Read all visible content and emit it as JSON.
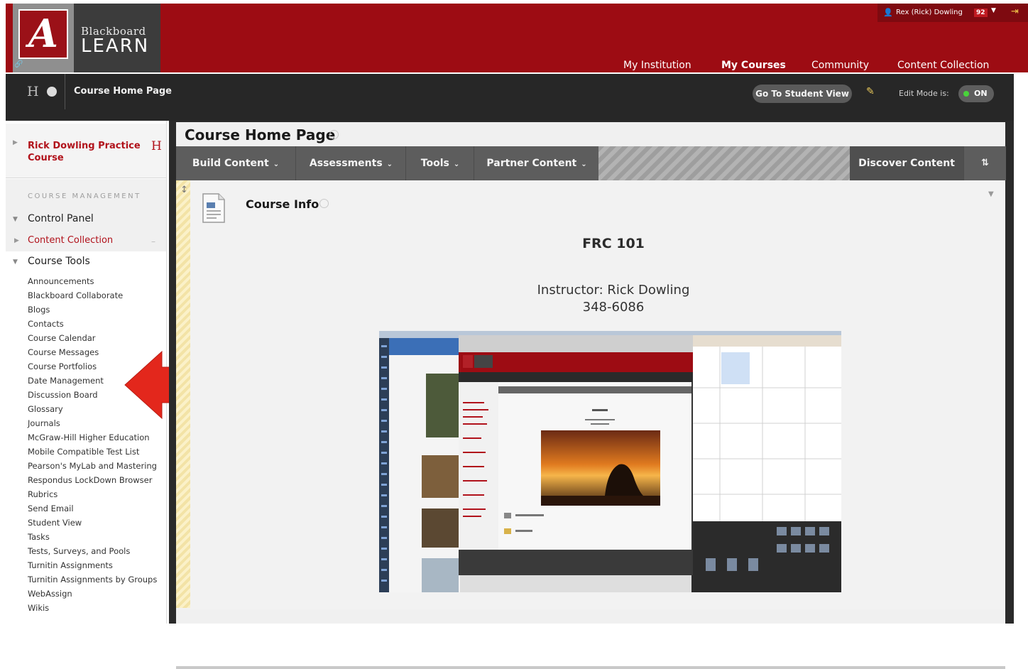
{
  "header": {
    "logo_letter": "A",
    "product_top": "Blackboard",
    "product_bottom": "LEARN",
    "user_name": "Rex (Rick) Dowling",
    "notification_count": "92",
    "tabs": [
      "My Institution",
      "My Courses",
      "Community",
      "Content Collection"
    ],
    "colors": {
      "brand_red": "#9d0c13",
      "dark_bar": "#272727",
      "link_red": "#b1121b"
    }
  },
  "nav": {
    "breadcrumb": "Course Home Page",
    "student_view_label": "Go To Student View",
    "edit_mode_label": "Edit Mode is:",
    "edit_mode_value": "ON"
  },
  "course_menu": {
    "course_title": "Rick Dowling Practice Course",
    "management_heading": "COURSE MANAGEMENT",
    "control_panel": "Control Panel",
    "content_collection": "Content Collection",
    "course_tools_heading": "Course Tools",
    "tools": [
      "Announcements",
      "Blackboard Collaborate",
      "Blogs",
      "Contacts",
      "Course Calendar",
      "Course Messages",
      "Course Portfolios",
      "Date Management",
      "Discussion Board",
      "Glossary",
      "Journals",
      "McGraw-Hill Higher Education",
      "Mobile Compatible Test List",
      "Pearson's MyLab and Mastering",
      "Respondus LockDown Browser",
      "Rubrics",
      "Send Email",
      "Student View",
      "Tasks",
      "Tests, Surveys, and Pools",
      "Turnitin Assignments",
      "Turnitin Assignments by Groups",
      "WebAssign",
      "Wikis"
    ]
  },
  "content": {
    "page_title": "Course Home Page",
    "action_bar": {
      "build": "Build Content",
      "assessments": "Assessments",
      "tools": "Tools",
      "partner": "Partner Content",
      "discover": "Discover Content",
      "sort_icon": "⇅"
    },
    "item": {
      "title": "Course Info",
      "course_code": "FRC 101",
      "instructor": "Instructor: Rick Dowling",
      "phone": "348-6086"
    }
  }
}
